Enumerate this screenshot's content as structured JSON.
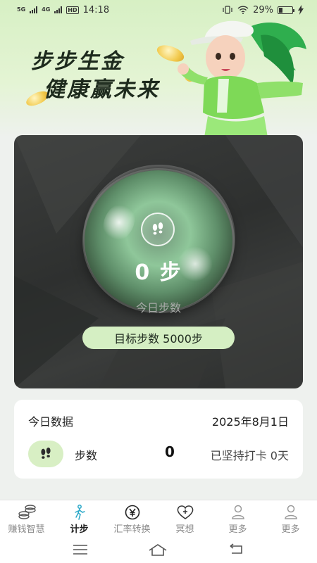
{
  "status_bar": {
    "signal1": "5G",
    "signal2": "4G",
    "hd": "HD",
    "time": "14:18",
    "battery_text": "29%",
    "battery_level": 0.29
  },
  "banner": {
    "title_line1": "步步生金",
    "title_line2": "健康赢未来"
  },
  "main_card": {
    "steps_value": "0 步",
    "today_label": "今日步数",
    "goal_label": "目标步数 5000步"
  },
  "data_card": {
    "title": "今日数据",
    "date": "2025年8月1日",
    "steps_label": "步数",
    "steps_count": "0",
    "streak": "已坚持打卡 0天"
  },
  "tabs": [
    {
      "label": "赚钱智慧",
      "icon": "coins-icon"
    },
    {
      "label": "计步",
      "icon": "walker-icon"
    },
    {
      "label": "汇率转换",
      "icon": "yen-icon"
    },
    {
      "label": "冥想",
      "icon": "heart-plus-icon"
    },
    {
      "label": "更多",
      "icon": "person-icon"
    },
    {
      "label": "更多",
      "icon": "person-icon"
    }
  ],
  "colors": {
    "accent": "#d5efc3",
    "active_tab": "#2aa8c8",
    "card_dark": "#333534"
  }
}
